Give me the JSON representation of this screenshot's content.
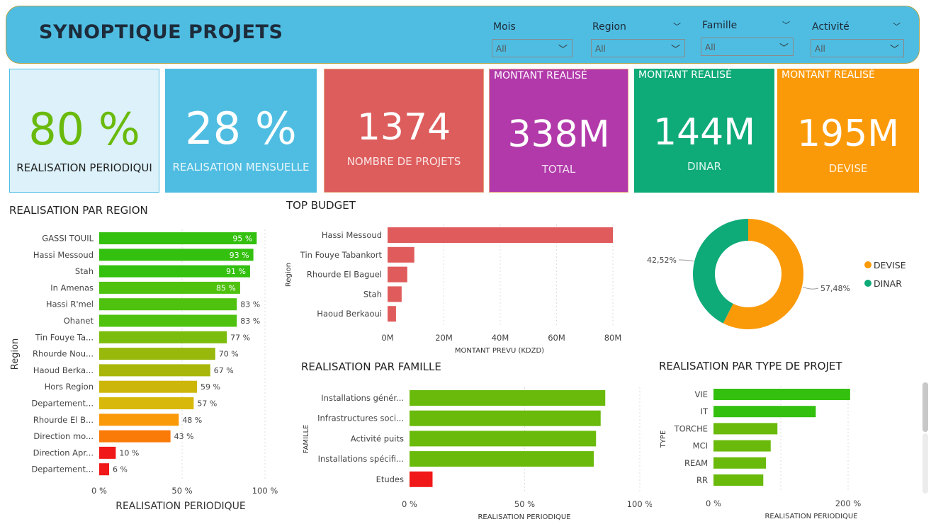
{
  "header": {
    "title": "SYNOPTIQUE PROJETS"
  },
  "slicers": [
    {
      "label": "Mois",
      "value": "All"
    },
    {
      "label": "Region",
      "value": "All"
    },
    {
      "label": "Famille",
      "value": "All"
    },
    {
      "label": "Activité",
      "value": "All"
    }
  ],
  "cards": {
    "periodique": {
      "value": "80 %",
      "label": "REALISATION PERIODIQUI"
    },
    "mensuelle": {
      "value": "28 %",
      "label": "REALISATION MENSUELLE"
    },
    "projets": {
      "value": "1374",
      "label": "NOMBRE DE PROJETS"
    },
    "total": {
      "header": "MONTANT REALISÉ",
      "value": "338M",
      "label": "TOTAL"
    },
    "dinar": {
      "header": "MONTANT REALISÉ",
      "value": "144M",
      "label": "DINAR"
    },
    "devise": {
      "header": "MONTANT REALISÉ",
      "value": "195M",
      "label": "DEVISE"
    }
  },
  "colors": {
    "header_bg": "#4fbde2",
    "green": "#6aba0c",
    "red_card": "#dd5c5c",
    "purple_card": "#b239aa",
    "teal_card": "#0eaa77",
    "orange_card": "#fb9a09",
    "bar_red": "#e05c5c"
  },
  "chart_data": [
    {
      "id": "region",
      "type": "bar",
      "orientation": "horizontal",
      "title": "REALISATION PAR REGION",
      "xlabel": "REALISATION PERIODIQUE",
      "ylabel": "Region",
      "xlim": [
        0,
        100
      ],
      "xticks": [
        "0 %",
        "50 %",
        "100 %"
      ],
      "categories": [
        "GASSI TOUIL",
        "Hassi Messoud",
        "Stah",
        "In Amenas",
        "Hassi R'mel",
        "Ohanet",
        "Tin Fouye Ta...",
        "Rhourde Nou...",
        "Haoud Berka...",
        "Hors Region",
        "Departement...",
        "Rhourde El B...",
        "Direction mo...",
        "Direction Apr...",
        "Departement..."
      ],
      "values": [
        95,
        93,
        91,
        85,
        83,
        83,
        77,
        70,
        67,
        59,
        57,
        48,
        43,
        10,
        6
      ],
      "data_labels": [
        "95 %",
        "93 %",
        "91 %",
        "85 %",
        "83 %",
        "83 %",
        "77 %",
        "70 %",
        "67 %",
        "59 %",
        "57 %",
        "48 %",
        "43 %",
        "10 %",
        "6 %"
      ],
      "colors": [
        "#33c00f",
        "#33c00f",
        "#33c00f",
        "#4ec20e",
        "#4ec20e",
        "#4ec20e",
        "#7bbd0c",
        "#98b80b",
        "#a8b60a",
        "#ccb60a",
        "#d8b80a",
        "#fb9a09",
        "#fb7b09",
        "#f01818",
        "#f01818"
      ]
    },
    {
      "id": "budget",
      "type": "bar",
      "orientation": "horizontal",
      "title": "TOP BUDGET",
      "xlabel": "MONTANT PREVU (KDZD)",
      "ylabel": "Region",
      "xlim": [
        0,
        80
      ],
      "xticks": [
        "0M",
        "20M",
        "40M",
        "60M",
        "80M"
      ],
      "categories": [
        "Hassi Messoud",
        "Tin Fouye Tabankort",
        "Rhourde El Baguel",
        "Stah",
        "Haoud Berkaoui"
      ],
      "values": [
        80,
        9.5,
        7,
        5,
        3
      ],
      "color": "#e05c5c"
    },
    {
      "id": "devise_dinar",
      "type": "pie",
      "donut": true,
      "legend": [
        "DEVISE",
        "DINAR"
      ],
      "values": [
        57.48,
        42.52
      ],
      "data_labels": [
        "57,48%",
        "42,52%"
      ],
      "colors": [
        "#fb9a09",
        "#0eaa77"
      ]
    },
    {
      "id": "famille",
      "type": "bar",
      "orientation": "horizontal",
      "title": "REALISATION PAR FAMILLE",
      "xlabel": "REALISATION PERIODIQUE",
      "ylabel": "FAMILLE",
      "xlim": [
        0,
        100
      ],
      "xticks": [
        "0 %",
        "50 %",
        "100 %"
      ],
      "categories": [
        "Installations génér...",
        "Infrastructures soci...",
        "Activité puits",
        "Installations spécifi...",
        "Etudes"
      ],
      "values": [
        85,
        83,
        81,
        80,
        10
      ],
      "colors": [
        "#6aba0c",
        "#6aba0c",
        "#6aba0c",
        "#6aba0c",
        "#f01818"
      ]
    },
    {
      "id": "type",
      "type": "bar",
      "orientation": "horizontal",
      "title": "REALISATION PAR TYPE DE PROJET",
      "xlabel": "REALISATION PERIODIQUE",
      "ylabel": "TYPE",
      "xlim": [
        0,
        200
      ],
      "xticks": [
        "0 %",
        "200 %"
      ],
      "categories": [
        "VIE",
        "IT",
        "TORCHE",
        "MCI",
        "REAM",
        "RR"
      ],
      "values": [
        203,
        152,
        95,
        85,
        78,
        74
      ],
      "colors": [
        "#33c00f",
        "#33c00f",
        "#6aba0c",
        "#6aba0c",
        "#6aba0c",
        "#6aba0c"
      ]
    }
  ]
}
